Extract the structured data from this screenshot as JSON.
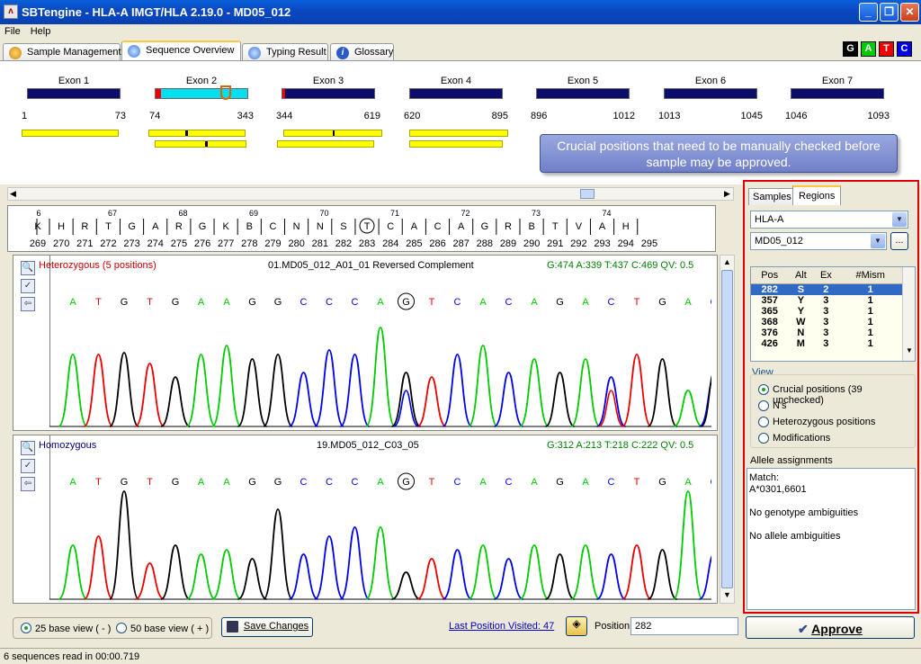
{
  "window": {
    "title": "SBTengine - HLA-A IMGT/HLA 2.19.0 - MD05_012",
    "app_icon": "sbtengine-icon"
  },
  "menu": [
    "File",
    "Help"
  ],
  "tabs": [
    {
      "label": "Sample Management",
      "icon": "samples-icon",
      "active": false
    },
    {
      "label": "Sequence Overview",
      "icon": "overview-icon",
      "active": true
    },
    {
      "label": "Typing Result",
      "icon": "result-icon",
      "active": false
    },
    {
      "label": "Glossary",
      "icon": "info-icon",
      "active": false
    }
  ],
  "base_legend": [
    {
      "l": "G",
      "c": "#000000"
    },
    {
      "l": "A",
      "c": "#00cc00"
    },
    {
      "l": "T",
      "c": "#ee0000"
    },
    {
      "l": "C",
      "c": "#0000ee"
    }
  ],
  "exons": [
    {
      "name": "Exon 1",
      "start": "1",
      "end": "73"
    },
    {
      "name": "Exon 2",
      "start": "74",
      "end": "343"
    },
    {
      "name": "Exon 3",
      "start": "344",
      "end": "619"
    },
    {
      "name": "Exon 4",
      "start": "620",
      "end": "895"
    },
    {
      "name": "Exon 5",
      "start": "896",
      "end": "1012"
    },
    {
      "name": "Exon 6",
      "start": "1013",
      "end": "1045"
    },
    {
      "name": "Exon 7",
      "start": "1046",
      "end": "1093"
    }
  ],
  "callout": "Crucial positions that need to be manually checked before sample may be approved.",
  "ruler": {
    "codons": [
      "67",
      "68",
      "69",
      "70",
      "71",
      "72",
      "73",
      "74"
    ],
    "first_codon": "6",
    "aa": [
      "K",
      "H",
      "R",
      "T",
      "G",
      "A",
      "R",
      "G",
      "K",
      "B",
      "C",
      "N",
      "N",
      "S",
      "T",
      "C",
      "A",
      "C",
      "A",
      "G",
      "R",
      "B",
      "T",
      "V",
      "A",
      "H"
    ],
    "positions": [
      "269",
      "270",
      "271",
      "272",
      "273",
      "274",
      "275",
      "276",
      "277",
      "278",
      "279",
      "280",
      "281",
      "282",
      "283",
      "284",
      "285",
      "286",
      "287",
      "288",
      "289",
      "290",
      "291",
      "292",
      "293",
      "294",
      "295"
    ]
  },
  "traces": [
    {
      "status": "Heterozygous (5 positions)",
      "status_color": "#cc0000",
      "name": "01.MD05_012_A01_01 Reversed Complement",
      "counts": "G:474 A:339 T:437 C:469 QV: 0.5"
    },
    {
      "status": "Homozygous",
      "status_color": "#000080",
      "name": "19.MD05_012_C03_05",
      "counts": "G:312 A:213 T:218 C:222 QV: 0.5"
    }
  ],
  "sequence": [
    "A",
    "T",
    "G",
    "T",
    "G",
    "A",
    "A",
    "G",
    "G",
    "C",
    "C",
    "C",
    "A",
    "G",
    "T",
    "C",
    "A",
    "C",
    "A",
    "G",
    "A",
    "C",
    "T",
    "G",
    "A",
    "C"
  ],
  "right": {
    "tabs": [
      "Samples",
      "Regions"
    ],
    "locus": "HLA-A",
    "sample": "MD05_012",
    "browse": "...",
    "cols": [
      "Pos",
      "Alt",
      "Ex",
      "#Mism"
    ],
    "rows": [
      [
        "282",
        "S",
        "2",
        "1"
      ],
      [
        "357",
        "Y",
        "3",
        "1"
      ],
      [
        "365",
        "Y",
        "3",
        "1"
      ],
      [
        "368",
        "W",
        "3",
        "1"
      ],
      [
        "376",
        "N",
        "3",
        "1"
      ],
      [
        "426",
        "M",
        "3",
        "1"
      ]
    ],
    "view_title": "View",
    "views": [
      "Crucial positions (39 unchecked)",
      "N's",
      "Heterozygous positions",
      "Modifications"
    ],
    "allele_title": "Allele assignments",
    "allele_lines": [
      "Match:",
      "A*0301,6601",
      "",
      "No genotype ambiguities",
      "",
      "No allele ambiguities"
    ]
  },
  "bottom": {
    "base25": "25 base view ( - )",
    "base50": "50 base view ( + )",
    "save": "Save Changes",
    "last_pos": "Last Position Visited: 47",
    "pos_label": "Position",
    "pos_value": "282",
    "approve": "Approve"
  },
  "status": "6 sequences read in 00:00.719"
}
